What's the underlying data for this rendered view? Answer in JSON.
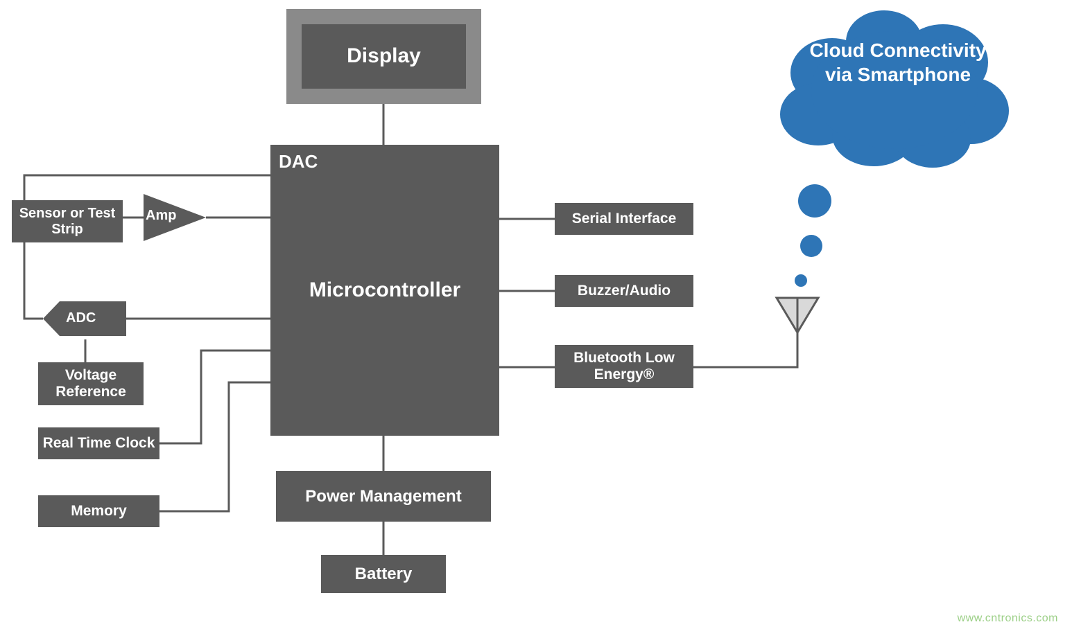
{
  "blocks": {
    "display": "Display",
    "dac": "DAC",
    "microcontroller": "Microcontroller",
    "sensor": "Sensor or Test Strip",
    "amp": "Amp",
    "adc": "ADC",
    "voltage_ref": "Voltage Reference",
    "rtc": "Real Time Clock",
    "memory": "Memory",
    "serial": "Serial Interface",
    "buzzer": "Buzzer/Audio",
    "ble": "Bluetooth Low Energy®",
    "power": "Power Management",
    "battery": "Battery"
  },
  "cloud": {
    "text": "Cloud Connectivity via Smartphone"
  },
  "watermark": "www.cntronics.com"
}
